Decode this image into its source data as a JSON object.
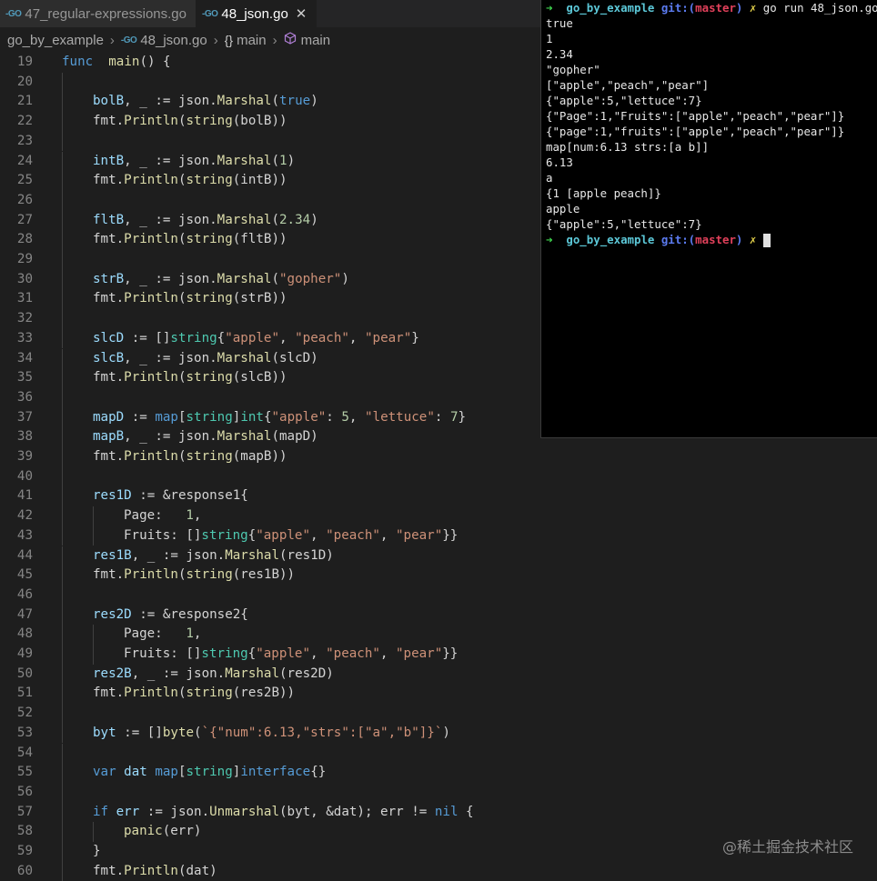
{
  "tabs": [
    {
      "icon": "go-file-icon",
      "label": "47_regular-expressions.go",
      "active": false
    },
    {
      "icon": "go-file-icon",
      "label": "48_json.go",
      "active": true
    }
  ],
  "go_badge": "-GO",
  "breadcrumb": {
    "folder": "go_by_example",
    "file": "48_json.go",
    "scope": "main",
    "symbol": "main",
    "scope_glyph": "{}"
  },
  "editor": {
    "lines": [
      {
        "n": "19",
        "i": 0,
        "t": [
          [
            "kw",
            "func"
          ],
          [
            "",
            "  "
          ],
          [
            "fn",
            "main"
          ],
          [
            "",
            "() {"
          ]
        ]
      },
      {
        "n": "20",
        "i": 1,
        "t": []
      },
      {
        "n": "21",
        "i": 1,
        "t": [
          [
            "var",
            "bolB"
          ],
          [
            "",
            ", _ := json."
          ],
          [
            "fn",
            "Marshal"
          ],
          [
            "",
            "("
          ],
          [
            "kw",
            "true"
          ],
          [
            "",
            ")"
          ]
        ]
      },
      {
        "n": "22",
        "i": 1,
        "t": [
          [
            "",
            "fmt."
          ],
          [
            "fn",
            "Println"
          ],
          [
            "",
            "("
          ],
          [
            "fn",
            "string"
          ],
          [
            "",
            "(bolB))"
          ]
        ]
      },
      {
        "n": "23",
        "i": 1,
        "t": []
      },
      {
        "n": "24",
        "i": 1,
        "t": [
          [
            "var",
            "intB"
          ],
          [
            "",
            ", _ := json."
          ],
          [
            "fn",
            "Marshal"
          ],
          [
            "",
            "("
          ],
          [
            "num",
            "1"
          ],
          [
            "",
            ")"
          ]
        ]
      },
      {
        "n": "25",
        "i": 1,
        "t": [
          [
            "",
            "fmt."
          ],
          [
            "fn",
            "Println"
          ],
          [
            "",
            "("
          ],
          [
            "fn",
            "string"
          ],
          [
            "",
            "(intB))"
          ]
        ]
      },
      {
        "n": "26",
        "i": 1,
        "t": []
      },
      {
        "n": "27",
        "i": 1,
        "t": [
          [
            "var",
            "fltB"
          ],
          [
            "",
            ", _ := json."
          ],
          [
            "fn",
            "Marshal"
          ],
          [
            "",
            "("
          ],
          [
            "num",
            "2.34"
          ],
          [
            "",
            ")"
          ]
        ]
      },
      {
        "n": "28",
        "i": 1,
        "t": [
          [
            "",
            "fmt."
          ],
          [
            "fn",
            "Println"
          ],
          [
            "",
            "("
          ],
          [
            "fn",
            "string"
          ],
          [
            "",
            "(fltB))"
          ]
        ]
      },
      {
        "n": "29",
        "i": 1,
        "t": []
      },
      {
        "n": "30",
        "i": 1,
        "t": [
          [
            "var",
            "strB"
          ],
          [
            "",
            ", _ := json."
          ],
          [
            "fn",
            "Marshal"
          ],
          [
            "",
            "("
          ],
          [
            "str",
            "\"gopher\""
          ],
          [
            "",
            ")"
          ]
        ]
      },
      {
        "n": "31",
        "i": 1,
        "t": [
          [
            "",
            "fmt."
          ],
          [
            "fn",
            "Println"
          ],
          [
            "",
            "("
          ],
          [
            "fn",
            "string"
          ],
          [
            "",
            "(strB))"
          ]
        ]
      },
      {
        "n": "32",
        "i": 1,
        "t": []
      },
      {
        "n": "33",
        "i": 1,
        "t": [
          [
            "var",
            "slcD"
          ],
          [
            "",
            " := []"
          ],
          [
            "typ",
            "string"
          ],
          [
            "",
            "{"
          ],
          [
            "str",
            "\"apple\""
          ],
          [
            "",
            ", "
          ],
          [
            "str",
            "\"peach\""
          ],
          [
            "",
            ", "
          ],
          [
            "str",
            "\"pear\""
          ],
          [
            "",
            "}"
          ]
        ]
      },
      {
        "n": "34",
        "i": 1,
        "t": [
          [
            "var",
            "slcB"
          ],
          [
            "",
            ", _ := json."
          ],
          [
            "fn",
            "Marshal"
          ],
          [
            "",
            "(slcD)"
          ]
        ]
      },
      {
        "n": "35",
        "i": 1,
        "t": [
          [
            "",
            "fmt."
          ],
          [
            "fn",
            "Println"
          ],
          [
            "",
            "("
          ],
          [
            "fn",
            "string"
          ],
          [
            "",
            "(slcB))"
          ]
        ]
      },
      {
        "n": "36",
        "i": 1,
        "t": []
      },
      {
        "n": "37",
        "i": 1,
        "t": [
          [
            "var",
            "mapD"
          ],
          [
            "",
            " := "
          ],
          [
            "kw",
            "map"
          ],
          [
            "",
            "["
          ],
          [
            "typ",
            "string"
          ],
          [
            "",
            "]"
          ],
          [
            "typ",
            "int"
          ],
          [
            "",
            "{"
          ],
          [
            "str",
            "\"apple\""
          ],
          [
            "",
            ": "
          ],
          [
            "num",
            "5"
          ],
          [
            "",
            ", "
          ],
          [
            "str",
            "\"lettuce\""
          ],
          [
            "",
            ": "
          ],
          [
            "num",
            "7"
          ],
          [
            "",
            "}"
          ]
        ]
      },
      {
        "n": "38",
        "i": 1,
        "t": [
          [
            "var",
            "mapB"
          ],
          [
            "",
            ", _ := json."
          ],
          [
            "fn",
            "Marshal"
          ],
          [
            "",
            "(mapD)"
          ]
        ]
      },
      {
        "n": "39",
        "i": 1,
        "t": [
          [
            "",
            "fmt."
          ],
          [
            "fn",
            "Println"
          ],
          [
            "",
            "("
          ],
          [
            "fn",
            "string"
          ],
          [
            "",
            "(mapB))"
          ]
        ]
      },
      {
        "n": "40",
        "i": 1,
        "t": []
      },
      {
        "n": "41",
        "i": 1,
        "t": [
          [
            "var",
            "res1D"
          ],
          [
            "",
            " := &response1{"
          ]
        ]
      },
      {
        "n": "42",
        "i": 2,
        "t": [
          [
            "",
            "Page:   "
          ],
          [
            "num",
            "1"
          ],
          [
            "",
            ","
          ]
        ]
      },
      {
        "n": "43",
        "i": 2,
        "t": [
          [
            "",
            "Fruits: []"
          ],
          [
            "typ",
            "string"
          ],
          [
            "",
            "{"
          ],
          [
            "str",
            "\"apple\""
          ],
          [
            "",
            ", "
          ],
          [
            "str",
            "\"peach\""
          ],
          [
            "",
            ", "
          ],
          [
            "str",
            "\"pear\""
          ],
          [
            "",
            "}}"
          ]
        ]
      },
      {
        "n": "44",
        "i": 1,
        "t": [
          [
            "var",
            "res1B"
          ],
          [
            "",
            ", _ := json."
          ],
          [
            "fn",
            "Marshal"
          ],
          [
            "",
            "(res1D)"
          ]
        ]
      },
      {
        "n": "45",
        "i": 1,
        "t": [
          [
            "",
            "fmt."
          ],
          [
            "fn",
            "Println"
          ],
          [
            "",
            "("
          ],
          [
            "fn",
            "string"
          ],
          [
            "",
            "(res1B))"
          ]
        ]
      },
      {
        "n": "46",
        "i": 1,
        "t": []
      },
      {
        "n": "47",
        "i": 1,
        "t": [
          [
            "var",
            "res2D"
          ],
          [
            "",
            " := &response2{"
          ]
        ]
      },
      {
        "n": "48",
        "i": 2,
        "t": [
          [
            "",
            "Page:   "
          ],
          [
            "num",
            "1"
          ],
          [
            "",
            ","
          ]
        ]
      },
      {
        "n": "49",
        "i": 2,
        "t": [
          [
            "",
            "Fruits: []"
          ],
          [
            "typ",
            "string"
          ],
          [
            "",
            "{"
          ],
          [
            "str",
            "\"apple\""
          ],
          [
            "",
            ", "
          ],
          [
            "str",
            "\"peach\""
          ],
          [
            "",
            ", "
          ],
          [
            "str",
            "\"pear\""
          ],
          [
            "",
            "}}"
          ]
        ]
      },
      {
        "n": "50",
        "i": 1,
        "t": [
          [
            "var",
            "res2B"
          ],
          [
            "",
            ", _ := json."
          ],
          [
            "fn",
            "Marshal"
          ],
          [
            "",
            "(res2D)"
          ]
        ]
      },
      {
        "n": "51",
        "i": 1,
        "t": [
          [
            "",
            "fmt."
          ],
          [
            "fn",
            "Println"
          ],
          [
            "",
            "("
          ],
          [
            "fn",
            "string"
          ],
          [
            "",
            "(res2B))"
          ]
        ]
      },
      {
        "n": "52",
        "i": 1,
        "t": []
      },
      {
        "n": "53",
        "i": 1,
        "t": [
          [
            "var",
            "byt"
          ],
          [
            "",
            " := []"
          ],
          [
            "fn",
            "byte"
          ],
          [
            "",
            "("
          ],
          [
            "str",
            "`{\"num\":6.13,\"strs\":[\"a\",\"b\"]}`"
          ],
          [
            "",
            ")"
          ]
        ]
      },
      {
        "n": "54",
        "i": 1,
        "t": []
      },
      {
        "n": "55",
        "i": 1,
        "t": [
          [
            "kw",
            "var"
          ],
          [
            "",
            " "
          ],
          [
            "var",
            "dat"
          ],
          [
            "",
            " "
          ],
          [
            "kw",
            "map"
          ],
          [
            "",
            "["
          ],
          [
            "typ",
            "string"
          ],
          [
            "",
            "]"
          ],
          [
            "kw",
            "interface"
          ],
          [
            "",
            "{}"
          ]
        ]
      },
      {
        "n": "56",
        "i": 1,
        "t": []
      },
      {
        "n": "57",
        "i": 1,
        "t": [
          [
            "kw",
            "if"
          ],
          [
            "",
            " "
          ],
          [
            "var",
            "err"
          ],
          [
            "",
            " := json."
          ],
          [
            "fn",
            "Unmarshal"
          ],
          [
            "",
            "(byt, &dat); err != "
          ],
          [
            "kw",
            "nil"
          ],
          [
            "",
            " {"
          ]
        ]
      },
      {
        "n": "58",
        "i": 2,
        "t": [
          [
            "fn",
            "panic"
          ],
          [
            "",
            "(err)"
          ]
        ]
      },
      {
        "n": "59",
        "i": 1,
        "t": [
          [
            "",
            "}"
          ]
        ]
      },
      {
        "n": "60",
        "i": 1,
        "t": [
          [
            "",
            "fmt."
          ],
          [
            "fn",
            "Println"
          ],
          [
            "",
            "(dat)"
          ]
        ]
      }
    ]
  },
  "terminal": {
    "prompt_arrow": "➜",
    "dir": "go_by_example",
    "git_label": "git:(",
    "branch": "master",
    "git_close": ")",
    "dirty_mark": "✗",
    "command": "go run 48_json.go",
    "output": [
      "true",
      "1",
      "2.34",
      "\"gopher\"",
      "[\"apple\",\"peach\",\"pear\"]",
      "{\"apple\":5,\"lettuce\":7}",
      "{\"Page\":1,\"Fruits\":[\"apple\",\"peach\",\"pear\"]}",
      "{\"page\":1,\"fruits\":[\"apple\",\"peach\",\"pear\"]}",
      "map[num:6.13 strs:[a b]]",
      "6.13",
      "a",
      "{1 [apple peach]}",
      "apple",
      "{\"apple\":5,\"lettuce\":7}"
    ]
  },
  "watermark": "@稀土掘金技术社区"
}
